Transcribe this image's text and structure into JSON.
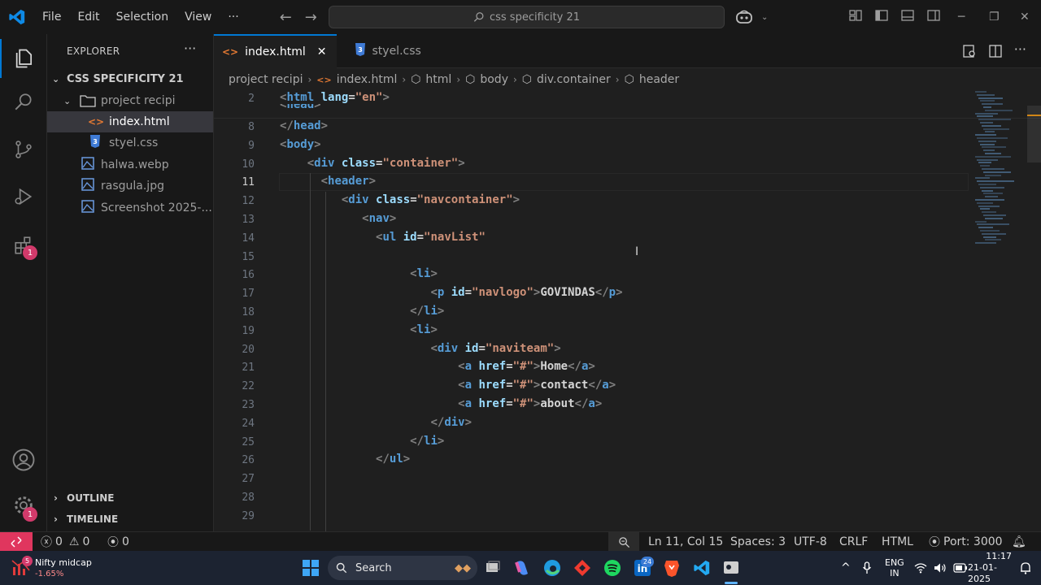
{
  "menu": [
    "File",
    "Edit",
    "Selection",
    "View"
  ],
  "command_center": "css specificity 21",
  "explorer": {
    "title": "EXPLORER",
    "project": "CSS SPECIFICITY 21",
    "items": [
      {
        "label": "project recipi",
        "type": "folder"
      },
      {
        "label": "index.html",
        "type": "html"
      },
      {
        "label": "styel.css",
        "type": "css"
      },
      {
        "label": "halwa.webp",
        "type": "image"
      },
      {
        "label": "rasgula.jpg",
        "type": "image"
      },
      {
        "label": "Screenshot 2025-...",
        "type": "image"
      }
    ],
    "outline": "OUTLINE",
    "timeline": "TIMELINE"
  },
  "activity_badges": {
    "extensions": "1",
    "settings": "1"
  },
  "tabs": [
    {
      "label": "index.html",
      "active": true
    },
    {
      "label": "styel.css",
      "active": false
    }
  ],
  "breadcrumb": [
    "project recipi",
    "index.html",
    "html",
    "body",
    "div.container",
    "header"
  ],
  "editor": {
    "sticky": [
      {
        "num": "2",
        "code": "<html lang=\"en\">"
      },
      {
        "num": "",
        "code": "<head>"
      }
    ],
    "lines": [
      {
        "num": "8",
        "code": "</head>"
      },
      {
        "num": "9",
        "code": "<body>"
      },
      {
        "num": "10",
        "code": "    <div class=\"container\">"
      },
      {
        "num": "11",
        "code": "      <header>"
      },
      {
        "num": "12",
        "code": "         <div class=\"navcontainer\">"
      },
      {
        "num": "13",
        "code": "            <nav>"
      },
      {
        "num": "14",
        "code": "              <ul id=\"navList\""
      },
      {
        "num": "15",
        "code": ""
      },
      {
        "num": "16",
        "code": "                   <li>"
      },
      {
        "num": "17",
        "code": "                      <p id=\"navlogo\">GOVINDAS</p>"
      },
      {
        "num": "18",
        "code": "                   </li>"
      },
      {
        "num": "19",
        "code": "                   <li>"
      },
      {
        "num": "20",
        "code": "                      <div id=\"naviteam\">"
      },
      {
        "num": "21",
        "code": "                          <a href=\"#\">Home</a>"
      },
      {
        "num": "22",
        "code": "                          <a href=\"#\">contact</a>"
      },
      {
        "num": "23",
        "code": "                          <a href=\"#\">about</a>"
      },
      {
        "num": "24",
        "code": "                      </div>"
      },
      {
        "num": "25",
        "code": "                   </li>"
      },
      {
        "num": "26",
        "code": "              </ul>"
      },
      {
        "num": "27",
        "code": ""
      },
      {
        "num": "28",
        "code": ""
      },
      {
        "num": "29",
        "code": ""
      }
    ],
    "current_line": "11"
  },
  "status": {
    "errors": "0",
    "warnings": "0",
    "ports": "0",
    "position": "Ln 11, Col 15",
    "spaces": "Spaces: 3",
    "encoding": "UTF-8",
    "eol": "CRLF",
    "language": "HTML",
    "port": "Port: 3000"
  },
  "taskbar": {
    "widget_title": "Nifty midcap",
    "widget_value": "-1.65%",
    "widget_badge": "5",
    "search": "Search",
    "linkedin_badge": "24",
    "lang_top": "ENG",
    "lang_bottom": "IN",
    "time": "11:17",
    "date": "21-01-2025"
  },
  "colors": {
    "accent": "#0078d4",
    "badge": "#d23a6b",
    "tag": "#569cd6",
    "attr": "#9cdcfe",
    "string": "#ce9178",
    "remote": "#e0365e"
  }
}
